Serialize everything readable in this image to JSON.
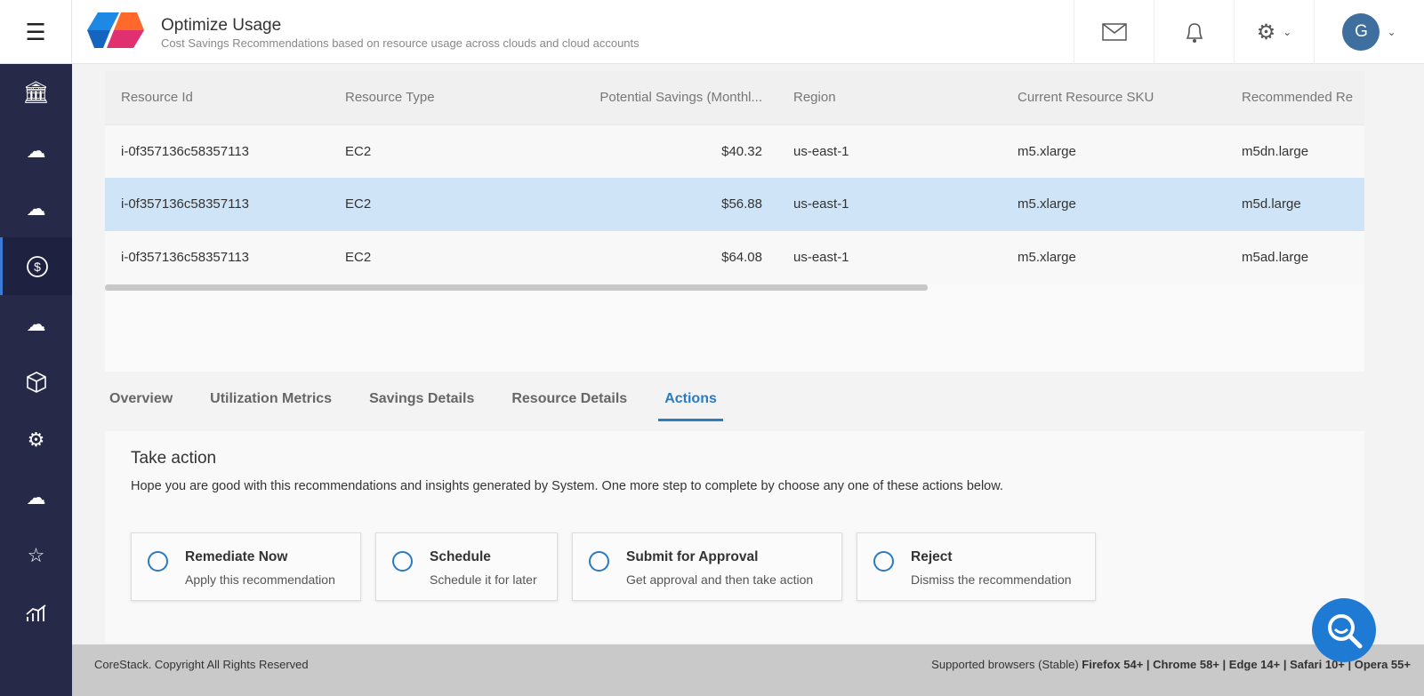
{
  "header": {
    "title": "Optimize Usage",
    "subtitle": "Cost Savings Recommendations based on resource usage across clouds and cloud accounts",
    "avatar_initial": "G"
  },
  "sidebar": {
    "items": [
      "bank-icon",
      "cloud-network-icon",
      "cloud-settings-icon",
      "dollar-icon",
      "cloud-lock-icon",
      "cube-icon",
      "gear-cycle-icon",
      "cloud-users-icon",
      "star-icon",
      "chart-icon"
    ],
    "active": "dollar-icon"
  },
  "table": {
    "columns": [
      "Resource Id",
      "Resource Type",
      "Potential Savings (Monthl...",
      "Region",
      "Current Resource SKU",
      "Recommended Re"
    ],
    "rows": [
      [
        "i-0f357136c58357113",
        "EC2",
        "$40.32",
        "us-east-1",
        "m5.xlarge",
        "m5dn.large"
      ],
      [
        "i-0f357136c58357113",
        "EC2",
        "$56.88",
        "us-east-1",
        "m5.xlarge",
        "m5d.large"
      ],
      [
        "i-0f357136c58357113",
        "EC2",
        "$64.08",
        "us-east-1",
        "m5.xlarge",
        "m5ad.large"
      ]
    ]
  },
  "tabs": [
    "Overview",
    "Utilization Metrics",
    "Savings Details",
    "Resource Details",
    "Actions"
  ],
  "active_tab": "Actions",
  "panel": {
    "title": "Take action",
    "description": "Hope you are good with this recommendations and insights generated by System. One more step to complete by choose any one of these actions below.",
    "options": [
      {
        "label": "Remediate Now",
        "sub": "Apply this recommendation"
      },
      {
        "label": "Schedule",
        "sub": "Schedule it for later"
      },
      {
        "label": "Submit for Approval",
        "sub": "Get approval and then take action"
      },
      {
        "label": "Reject",
        "sub": "Dismiss the recommendation"
      }
    ]
  },
  "footer": {
    "copyright": "CoreStack. Copyright All Rights Reserved",
    "browsers_prefix": "Supported browsers (Stable)",
    "browsers": "Firefox 54+ | Chrome 58+ | Edge 14+ | Safari 10+ | Opera 55+"
  },
  "colors": {
    "accent": "#2a7bbf",
    "sidebar": "#262a48",
    "selected_row": "#cfe4f6"
  }
}
